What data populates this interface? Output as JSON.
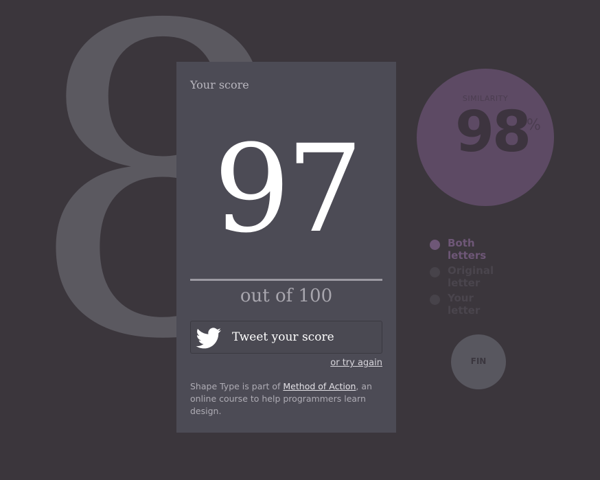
{
  "background_letter": "8",
  "panel": {
    "title": "Your score",
    "score": "97",
    "out_of": "out of 100",
    "tweet_label": "Tweet your score",
    "try_again": "or try again",
    "footer_prefix": "Shape Type is part of ",
    "footer_link": "Method of Action",
    "footer_suffix": ", an online course to help programmers learn design."
  },
  "similarity": {
    "label": "SIMILARITY",
    "value": "98",
    "percent_sign": "%"
  },
  "legend": [
    {
      "label": "Both letters",
      "active": true
    },
    {
      "label": "Original letter",
      "active": false
    },
    {
      "label": "Your letter",
      "active": false
    }
  ],
  "fin_button": "FIN",
  "icons": {
    "tweet": "twitter-bird-icon"
  },
  "colors": {
    "background": "#3b363c",
    "panel": "#4c4b55",
    "similarity_circle": "#5d4a64",
    "active_legend": "#6e5777"
  }
}
